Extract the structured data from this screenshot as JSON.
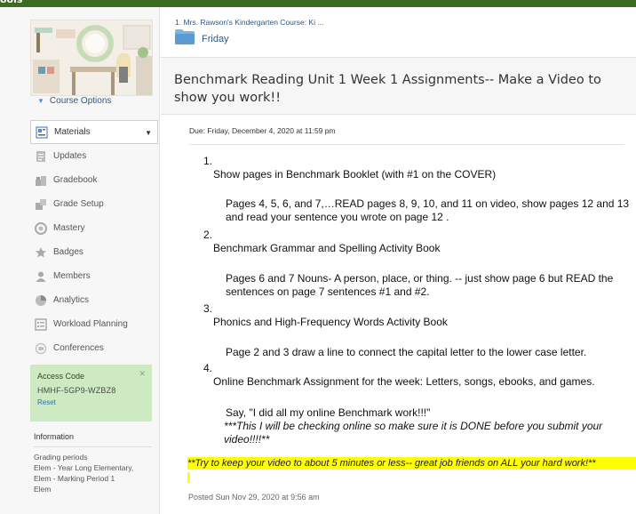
{
  "topbar": {
    "brand_fragment": "ools"
  },
  "sidebar": {
    "course_options_label": "Course Options",
    "menu": [
      {
        "label": "Materials",
        "icon": "materials-icon",
        "active": true
      },
      {
        "label": "Updates",
        "icon": "updates-icon"
      },
      {
        "label": "Gradebook",
        "icon": "gradebook-icon"
      },
      {
        "label": "Grade Setup",
        "icon": "grade-setup-icon"
      },
      {
        "label": "Mastery",
        "icon": "mastery-icon"
      },
      {
        "label": "Badges",
        "icon": "badge-icon"
      },
      {
        "label": "Members",
        "icon": "members-icon"
      },
      {
        "label": "Analytics",
        "icon": "analytics-icon"
      },
      {
        "label": "Workload Planning",
        "icon": "workload-icon"
      },
      {
        "label": "Conferences",
        "icon": "conferences-icon"
      }
    ],
    "access": {
      "label": "Access Code",
      "code": "HMHF-5GP9-WZBZ8",
      "reset_label": "Reset",
      "close_glyph": "✕"
    },
    "info": {
      "title": "Information",
      "lines": [
        "Grading periods",
        "Elem - Year Long Elementary,",
        "Elem - Marking Period 1",
        "Elem"
      ]
    }
  },
  "main": {
    "breadcrumb": "1. Mrs. Rawson's Kindergarten Course: Ki ...",
    "folder_label": "Friday",
    "title": "Benchmark Reading Unit 1 Week 1 Assignments-- Make a Video to show you work!!",
    "due": "Due: Friday, December 4, 2020 at 11:59 pm",
    "items": [
      {
        "number": "1.",
        "heading": "Show pages in Benchmark Booklet (with #1 on the COVER)",
        "detail": "Pages 4, 5, 6, and 7,…READ pages 8, 9, 10, and 11 on video, show pages 12 and 13 and read your sentence you wrote on page 12 ."
      },
      {
        "number": "2.",
        "heading": "Benchmark Grammar and Spelling Activity Book",
        "detail": "Pages 6 and 7 Nouns- A person, place, or thing.  -- just show page 6 but READ the sentences on page 7 sentences #1 and #2."
      },
      {
        "number": "3.",
        "heading": "Phonics and High-Frequency Words Activity Book",
        "detail": "Page 2 and 3 draw a line to connect the capital letter to the lower case letter."
      },
      {
        "number": "4.",
        "heading": "Online Benchmark Assignment for the week: Letters, songs, ebooks, and games.",
        "detail": "Say, \"I did all my online Benchmark work!!!\"",
        "detail_note": "***This I will be checking online so make sure it is DONE before you submit your video!!!!**"
      }
    ],
    "highlight_note": "**Try to keep your video to about 5 minutes or less-- great job friends on ALL your hard work!**",
    "posted": "Posted Sun Nov 29, 2020 at 9:56 am"
  },
  "colors": {
    "topbar": "#3b6b1f",
    "link": "#2a5a8a",
    "access_bg": "#cdeac2",
    "highlight": "#ffff00"
  }
}
